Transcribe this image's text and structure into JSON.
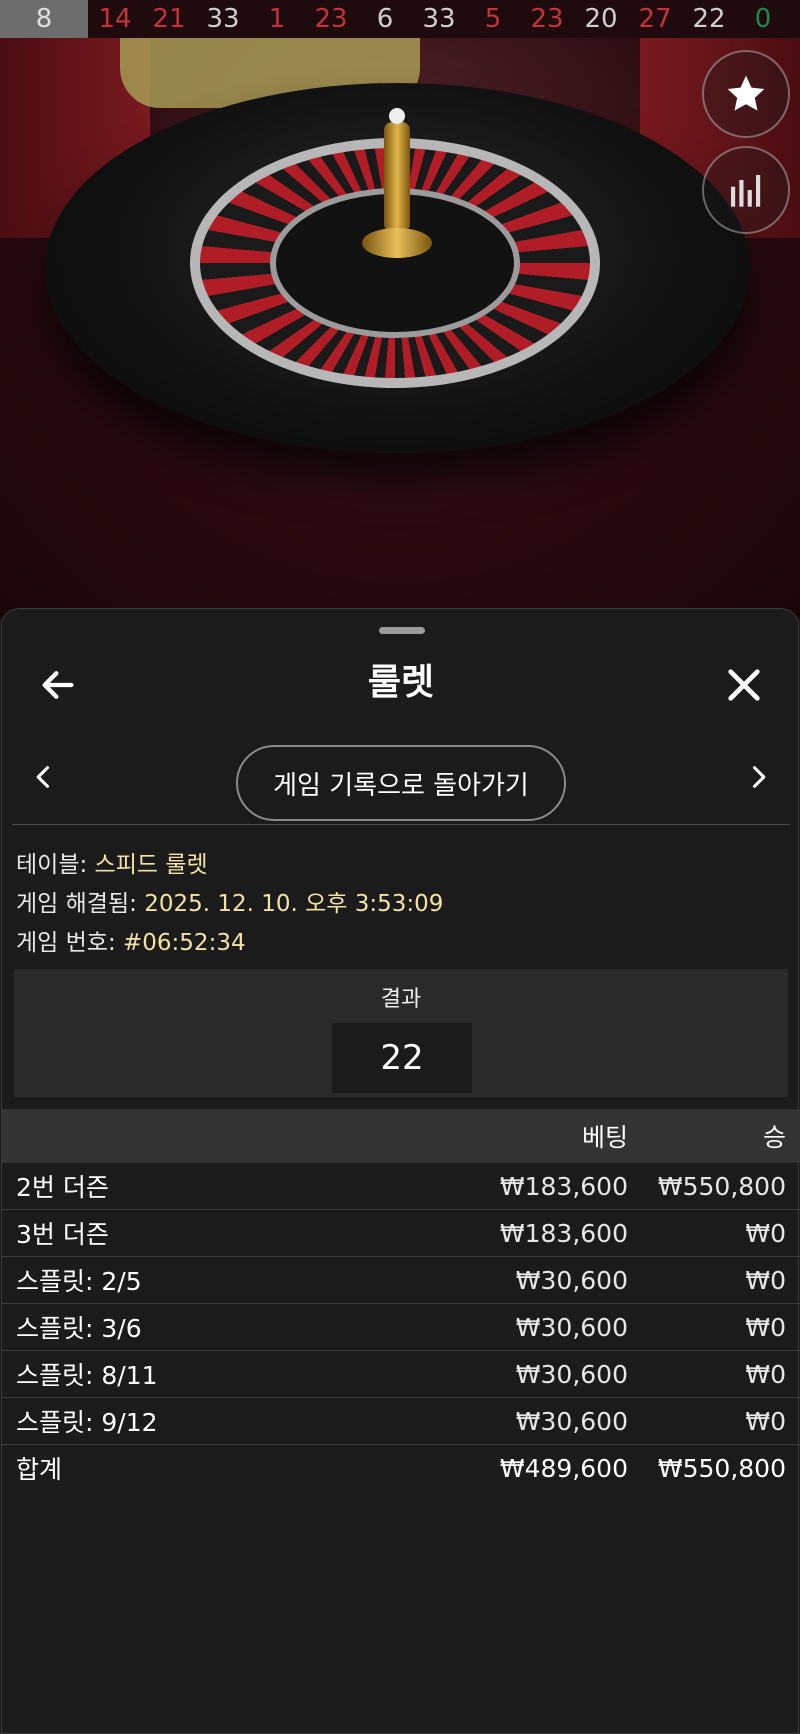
{
  "history": {
    "first": "8",
    "numbers": [
      {
        "value": "14",
        "color": "red"
      },
      {
        "value": "21",
        "color": "red"
      },
      {
        "value": "33",
        "color": "black"
      },
      {
        "value": "1",
        "color": "red"
      },
      {
        "value": "23",
        "color": "red"
      },
      {
        "value": "6",
        "color": "black"
      },
      {
        "value": "33",
        "color": "black"
      },
      {
        "value": "5",
        "color": "red"
      },
      {
        "value": "23",
        "color": "red"
      },
      {
        "value": "20",
        "color": "black"
      },
      {
        "value": "27",
        "color": "red"
      },
      {
        "value": "22",
        "color": "black"
      },
      {
        "value": "0",
        "color": "green"
      }
    ]
  },
  "video": {
    "favorite_icon": "star-icon",
    "stats_icon": "bar-chart-icon"
  },
  "sheet": {
    "title": "룰렛",
    "back_icon": "arrow-left-icon",
    "close_icon": "close-icon",
    "history_button": "게임 기록으로 돌아가기",
    "info": {
      "table_label": "테이블:",
      "table_value": "스피드 룰렛",
      "resolved_label": "게임 해결됨:",
      "resolved_value": "2025. 12. 10. 오후 3:53:09",
      "number_label": "게임 번호:",
      "number_value": "#06:52:34"
    },
    "result": {
      "label": "결과",
      "value": "22"
    },
    "bets": {
      "columns": {
        "name": "",
        "bet": "베팅",
        "win": "승"
      },
      "rows": [
        {
          "name": "2번 더즌",
          "bet": "₩183,600",
          "win": "₩550,800"
        },
        {
          "name": "3번 더즌",
          "bet": "₩183,600",
          "win": "₩0"
        },
        {
          "name": "스플릿: 2/5",
          "bet": "₩30,600",
          "win": "₩0"
        },
        {
          "name": "스플릿: 3/6",
          "bet": "₩30,600",
          "win": "₩0"
        },
        {
          "name": "스플릿: 8/11",
          "bet": "₩30,600",
          "win": "₩0"
        },
        {
          "name": "스플릿: 9/12",
          "bet": "₩30,600",
          "win": "₩0"
        }
      ],
      "total": {
        "name": "합계",
        "bet": "₩489,600",
        "win": "₩550,800"
      }
    }
  },
  "colors": {
    "red": "#c2333a",
    "black": "#cfcfcf",
    "green": "#1f8a4c",
    "accent_value": "#f3e2a6"
  }
}
